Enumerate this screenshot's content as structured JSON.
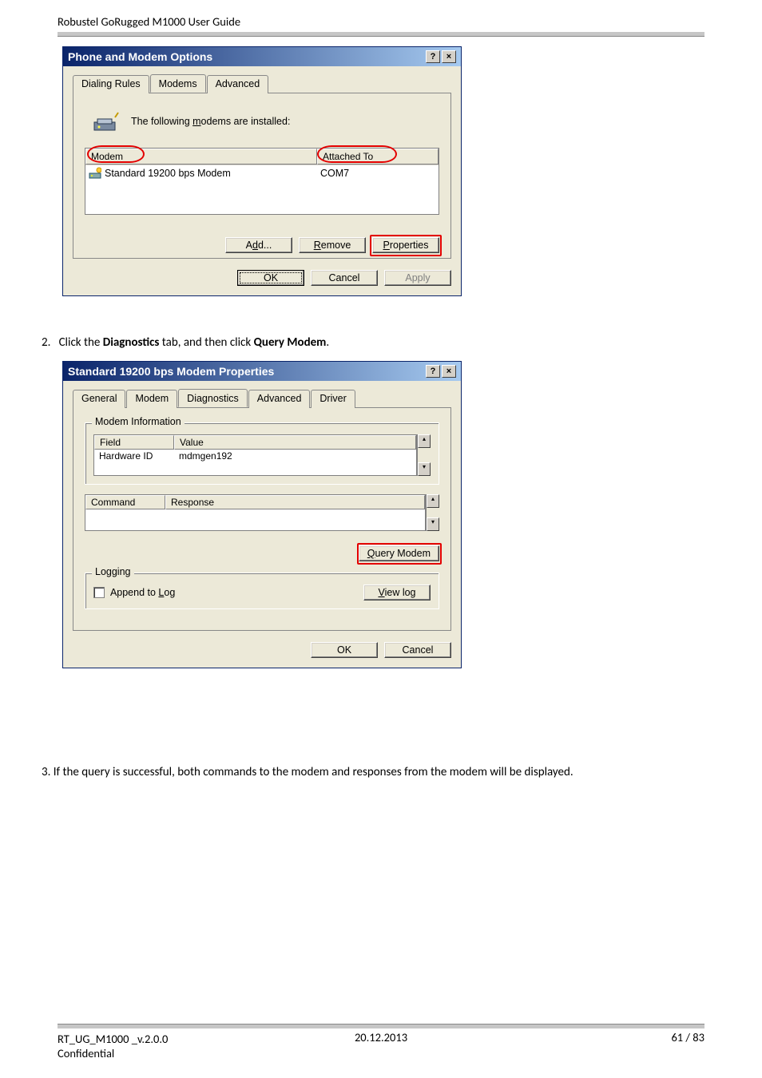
{
  "header": "Robustel GoRugged M1000 User Guide",
  "dialog1": {
    "title": "Phone and Modem Options",
    "help_btn": "?",
    "close_btn": "×",
    "tabs": {
      "dialing": "Dialing Rules",
      "modems": "Modems",
      "advanced": "Advanced"
    },
    "intro": "The following modems are installed:",
    "col_modem": "Modem",
    "col_attached": "Attached To",
    "row_name": "Standard 19200 bps Modem",
    "row_port": "COM7",
    "btn_add": "Add...",
    "btn_remove": "Remove",
    "btn_props": "Properties",
    "btn_ok": "OK",
    "btn_cancel": "Cancel",
    "btn_apply": "Apply"
  },
  "step2": "2.    Click the Diagnostics tab, and then click Query Modem.",
  "dialog2": {
    "title": "Standard 19200 bps Modem Properties",
    "help_btn": "?",
    "close_btn": "×",
    "tabs": {
      "general": "General",
      "modem": "Modem",
      "diag": "Diagnostics",
      "adv": "Advanced",
      "driver": "Driver"
    },
    "grp_info": "Modem Information",
    "col_field": "Field",
    "col_value": "Value",
    "row_field": "Hardware ID",
    "row_value": "mdmgen192",
    "col_command": "Command",
    "col_response": "Response",
    "btn_query": "Query Modem",
    "grp_log": "Logging",
    "chk_append": "Append to Log",
    "btn_viewlog": "View log",
    "btn_ok": "OK",
    "btn_cancel": "Cancel"
  },
  "step3": "3.    If the query is successful, both commands to the modem and responses from the modem will be displayed.",
  "footer": {
    "left1": "RT_UG_M1000 _v.2.0.0",
    "left2": "Confidential",
    "center": "20.12.2013",
    "right": "61 / 83"
  }
}
